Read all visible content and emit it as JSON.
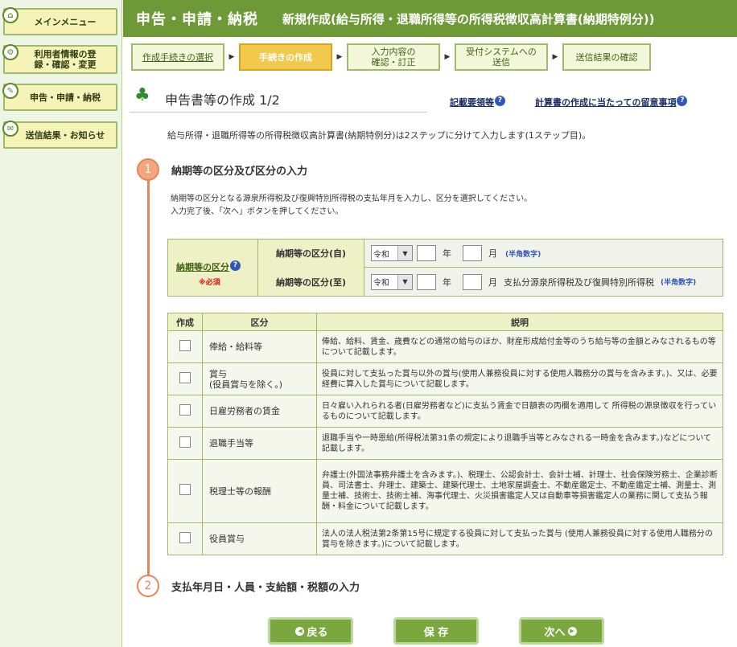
{
  "sidebar": {
    "items": [
      {
        "label": "メインメニュー"
      },
      {
        "label": "利用者情報の登録・確認・変更"
      },
      {
        "label": "申告・申請・納税"
      },
      {
        "label": "送信結果・お知らせ"
      }
    ]
  },
  "header": {
    "title": "申告・申請・納税",
    "subtitle": "新規作成(給与所得・退職所得等の所得税徴収高計算書(納期特例分))"
  },
  "steps": [
    {
      "label": "作成手続きの選択"
    },
    {
      "label": "手続きの作成"
    },
    {
      "label": "入力内容の\n確認・訂正"
    },
    {
      "label": "受付システムへの\n送信"
    },
    {
      "label": "送信結果の確認"
    }
  ],
  "page": {
    "heading": "申告書等の作成 1/2",
    "link_guide": "記載要領等",
    "link_notes": "計算書の作成に当たっての留意事項",
    "intro": "給与所得・退職所得等の所得税徴収高計算書(納期特例分)は2ステップに分けて入力します(1ステップ目)。"
  },
  "section1": {
    "number": "1",
    "title": "納期等の区分及び区分の入力",
    "instruction1": "納期等の区分となる源泉所得税及び復興特別所得税の支払年月を入力し、区分を選択してください。",
    "instruction2": "入力完了後、「次へ」ボタンを押してください。"
  },
  "period": {
    "label": "納期等の区分",
    "required": "※必須",
    "from_label": "納期等の区分(自)",
    "to_label": "納期等の区分(至)",
    "era": "令和",
    "year_unit": "年",
    "month_unit": "月",
    "half_width": "(半角数字)",
    "to_extra": "支払分源泉所得税及び復興特別所得税"
  },
  "table": {
    "headers": [
      "作成",
      "区分",
      "説明"
    ],
    "rows": [
      {
        "name": "俸給・給料等",
        "desc": "俸給、給料、賃金、歳費などの通常の給与のほか、財産形成給付金等のうち給与等の金額とみなされるもの等について記載します。"
      },
      {
        "name": "賞与\n(役員賞与を除く。)",
        "desc": "役員に対して支払った賞与以外の賞与(使用人兼務役員に対する使用人職務分の賞与を含みます。)、又は、必要経費に算入した賞与について記載します。"
      },
      {
        "name": "日雇労務者の賃金",
        "desc": "日々雇い入れられる者(日雇労務者など)に支払う賃金で日額表の丙欄を適用して 所得税の源泉徴収を行っているものについて記載します。"
      },
      {
        "name": "退職手当等",
        "desc": "退職手当や一時恩給(所得税法第31条の規定により退職手当等とみなされる一時金を含みます。)などについて記載します。"
      },
      {
        "name": "税理士等の報酬",
        "desc": "弁護士(外国法事務弁護士を含みます。)、税理士、公認会計士、会計士補、計理士、社会保険労務士、企業診断員、司法書士、弁理士、建築士、建築代理士、土地家屋調査士、不動産鑑定士、不動産鑑定士補、測量士、測量士補、技術士、技術士補、海事代理士、火災損害鑑定人又は自動車等損害鑑定人の業務に関して支払う報酬・料金について記載します。"
      },
      {
        "name": "役員賞与",
        "desc": "法人の法人税法第2条第15号に規定する役員に対して支払った賞与 (使用人兼務役員に対する使用人職務分の賞与を除きます。)について記載します。"
      }
    ]
  },
  "section2": {
    "number": "2",
    "title": "支払年月日・人員・支給額・税額の入力"
  },
  "buttons": {
    "back": "戻る",
    "save": "保 存",
    "next": "次へ"
  }
}
